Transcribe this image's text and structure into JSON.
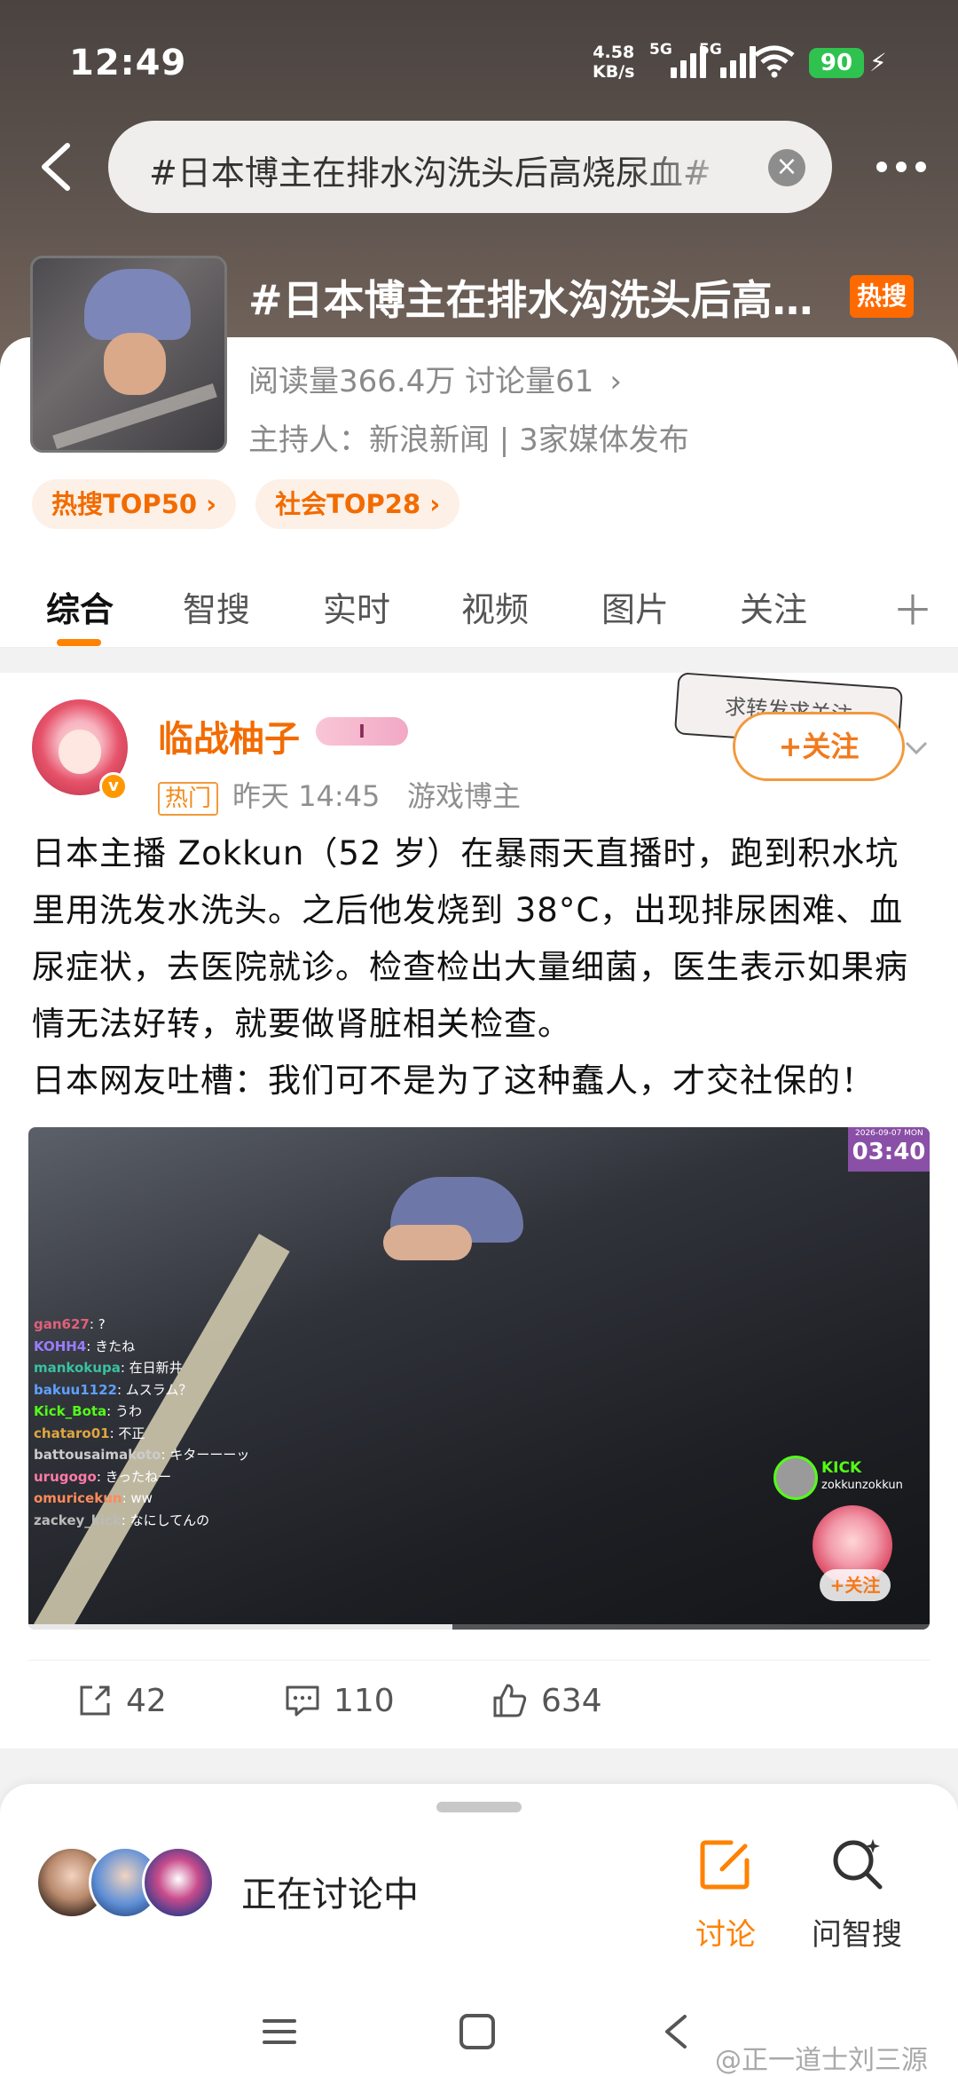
{
  "status_bar": {
    "time": "12:49",
    "net_speed": "4.58",
    "net_unit": "KB/s",
    "signal1": "5G",
    "signal2": "5G",
    "battery": "90"
  },
  "search": {
    "query": "#日本博主在排水沟洗头后高烧尿血#"
  },
  "topic": {
    "title": "#日本博主在排水沟洗头后高烧尿血#",
    "badge": "热搜",
    "stats": "阅读量366.4万  讨论量61",
    "host": "主持人：新浪新闻 | 3家媒体发布",
    "chips": [
      "热搜TOP50 ›",
      "社会TOP28 ›"
    ]
  },
  "tabs": [
    "综合",
    "智搜",
    "实时",
    "视频",
    "图片",
    "关注"
  ],
  "post": {
    "author": "临战柚子",
    "level_badge": "I",
    "hot_tag": "热门",
    "time": "昨天 14:45",
    "source": "游戏博主",
    "follow_label": "+关注",
    "deco_text": "求转发求关注",
    "paragraph1": "日本主播 Zokkun（52 岁）在暴雨天直播时，跑到积水坑里用洗发水洗头。之后他发烧到 38°C，出现排尿困难、血尿症状，去医院就诊。检查检出大量细菌，医生表示如果病情无法好转，就要做肾脏相关检查。",
    "paragraph2": "日本网友吐槽：我们可不是为了这种蠢人，才交社保的！",
    "video": {
      "timer": "03:40",
      "timer_date": "2026-09-07 MON",
      "chat": [
        {
          "user": "gan627",
          "msg": "?",
          "color": "#e0607a"
        },
        {
          "user": "KOHH4",
          "msg": "きたね",
          "color": "#9a7cff"
        },
        {
          "user": "mankokupa",
          "msg": "在日新井",
          "color": "#38c2a0"
        },
        {
          "user": "bakuu1122",
          "msg": "ムスラム？",
          "color": "#5fa0ff"
        },
        {
          "user": "Kick_Bota",
          "msg": "うわ",
          "color": "#53fc18"
        },
        {
          "user": "chataro01",
          "msg": "不正",
          "color": "#e0a640"
        },
        {
          "user": "battousaimakoto",
          "msg": "キターーーッ",
          "color": "#cccccc"
        },
        {
          "user": "urugogo",
          "msg": "きったねー",
          "color": "#ff7aa8"
        },
        {
          "user": "omuricekun",
          "msg": "ww",
          "color": "#ff8a5a"
        },
        {
          "user": "zackey_kick",
          "msg": "なにしてんの",
          "color": "#bbbbbb"
        }
      ],
      "kick_brand": "KICK",
      "kick_user": "zokkunzokkun",
      "kick_follow": "+关注",
      "progress": 0.47
    },
    "reposts": "42",
    "comments": "110",
    "likes": "634"
  },
  "bottom": {
    "discuss_text": "正在讨论中",
    "btn_discuss": "讨论",
    "btn_ai": "问智搜",
    "accent": "#ff8200"
  },
  "watermark": "@正一道士刘三源"
}
